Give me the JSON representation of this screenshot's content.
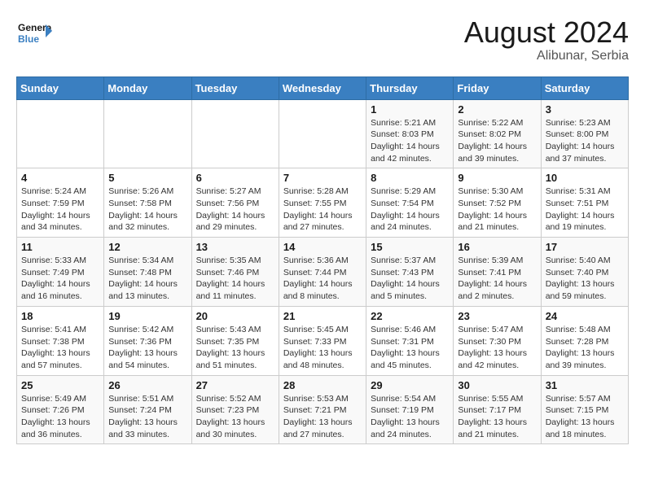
{
  "header": {
    "logo_general": "General",
    "logo_blue": "Blue",
    "title": "August 2024",
    "subtitle": "Alibunar, Serbia"
  },
  "weekdays": [
    "Sunday",
    "Monday",
    "Tuesday",
    "Wednesday",
    "Thursday",
    "Friday",
    "Saturday"
  ],
  "weeks": [
    [
      {
        "day": "",
        "info": ""
      },
      {
        "day": "",
        "info": ""
      },
      {
        "day": "",
        "info": ""
      },
      {
        "day": "",
        "info": ""
      },
      {
        "day": "1",
        "info": "Sunrise: 5:21 AM\nSunset: 8:03 PM\nDaylight: 14 hours\nand 42 minutes."
      },
      {
        "day": "2",
        "info": "Sunrise: 5:22 AM\nSunset: 8:02 PM\nDaylight: 14 hours\nand 39 minutes."
      },
      {
        "day": "3",
        "info": "Sunrise: 5:23 AM\nSunset: 8:00 PM\nDaylight: 14 hours\nand 37 minutes."
      }
    ],
    [
      {
        "day": "4",
        "info": "Sunrise: 5:24 AM\nSunset: 7:59 PM\nDaylight: 14 hours\nand 34 minutes."
      },
      {
        "day": "5",
        "info": "Sunrise: 5:26 AM\nSunset: 7:58 PM\nDaylight: 14 hours\nand 32 minutes."
      },
      {
        "day": "6",
        "info": "Sunrise: 5:27 AM\nSunset: 7:56 PM\nDaylight: 14 hours\nand 29 minutes."
      },
      {
        "day": "7",
        "info": "Sunrise: 5:28 AM\nSunset: 7:55 PM\nDaylight: 14 hours\nand 27 minutes."
      },
      {
        "day": "8",
        "info": "Sunrise: 5:29 AM\nSunset: 7:54 PM\nDaylight: 14 hours\nand 24 minutes."
      },
      {
        "day": "9",
        "info": "Sunrise: 5:30 AM\nSunset: 7:52 PM\nDaylight: 14 hours\nand 21 minutes."
      },
      {
        "day": "10",
        "info": "Sunrise: 5:31 AM\nSunset: 7:51 PM\nDaylight: 14 hours\nand 19 minutes."
      }
    ],
    [
      {
        "day": "11",
        "info": "Sunrise: 5:33 AM\nSunset: 7:49 PM\nDaylight: 14 hours\nand 16 minutes."
      },
      {
        "day": "12",
        "info": "Sunrise: 5:34 AM\nSunset: 7:48 PM\nDaylight: 14 hours\nand 13 minutes."
      },
      {
        "day": "13",
        "info": "Sunrise: 5:35 AM\nSunset: 7:46 PM\nDaylight: 14 hours\nand 11 minutes."
      },
      {
        "day": "14",
        "info": "Sunrise: 5:36 AM\nSunset: 7:44 PM\nDaylight: 14 hours\nand 8 minutes."
      },
      {
        "day": "15",
        "info": "Sunrise: 5:37 AM\nSunset: 7:43 PM\nDaylight: 14 hours\nand 5 minutes."
      },
      {
        "day": "16",
        "info": "Sunrise: 5:39 AM\nSunset: 7:41 PM\nDaylight: 14 hours\nand 2 minutes."
      },
      {
        "day": "17",
        "info": "Sunrise: 5:40 AM\nSunset: 7:40 PM\nDaylight: 13 hours\nand 59 minutes."
      }
    ],
    [
      {
        "day": "18",
        "info": "Sunrise: 5:41 AM\nSunset: 7:38 PM\nDaylight: 13 hours\nand 57 minutes."
      },
      {
        "day": "19",
        "info": "Sunrise: 5:42 AM\nSunset: 7:36 PM\nDaylight: 13 hours\nand 54 minutes."
      },
      {
        "day": "20",
        "info": "Sunrise: 5:43 AM\nSunset: 7:35 PM\nDaylight: 13 hours\nand 51 minutes."
      },
      {
        "day": "21",
        "info": "Sunrise: 5:45 AM\nSunset: 7:33 PM\nDaylight: 13 hours\nand 48 minutes."
      },
      {
        "day": "22",
        "info": "Sunrise: 5:46 AM\nSunset: 7:31 PM\nDaylight: 13 hours\nand 45 minutes."
      },
      {
        "day": "23",
        "info": "Sunrise: 5:47 AM\nSunset: 7:30 PM\nDaylight: 13 hours\nand 42 minutes."
      },
      {
        "day": "24",
        "info": "Sunrise: 5:48 AM\nSunset: 7:28 PM\nDaylight: 13 hours\nand 39 minutes."
      }
    ],
    [
      {
        "day": "25",
        "info": "Sunrise: 5:49 AM\nSunset: 7:26 PM\nDaylight: 13 hours\nand 36 minutes."
      },
      {
        "day": "26",
        "info": "Sunrise: 5:51 AM\nSunset: 7:24 PM\nDaylight: 13 hours\nand 33 minutes."
      },
      {
        "day": "27",
        "info": "Sunrise: 5:52 AM\nSunset: 7:23 PM\nDaylight: 13 hours\nand 30 minutes."
      },
      {
        "day": "28",
        "info": "Sunrise: 5:53 AM\nSunset: 7:21 PM\nDaylight: 13 hours\nand 27 minutes."
      },
      {
        "day": "29",
        "info": "Sunrise: 5:54 AM\nSunset: 7:19 PM\nDaylight: 13 hours\nand 24 minutes."
      },
      {
        "day": "30",
        "info": "Sunrise: 5:55 AM\nSunset: 7:17 PM\nDaylight: 13 hours\nand 21 minutes."
      },
      {
        "day": "31",
        "info": "Sunrise: 5:57 AM\nSunset: 7:15 PM\nDaylight: 13 hours\nand 18 minutes."
      }
    ]
  ]
}
